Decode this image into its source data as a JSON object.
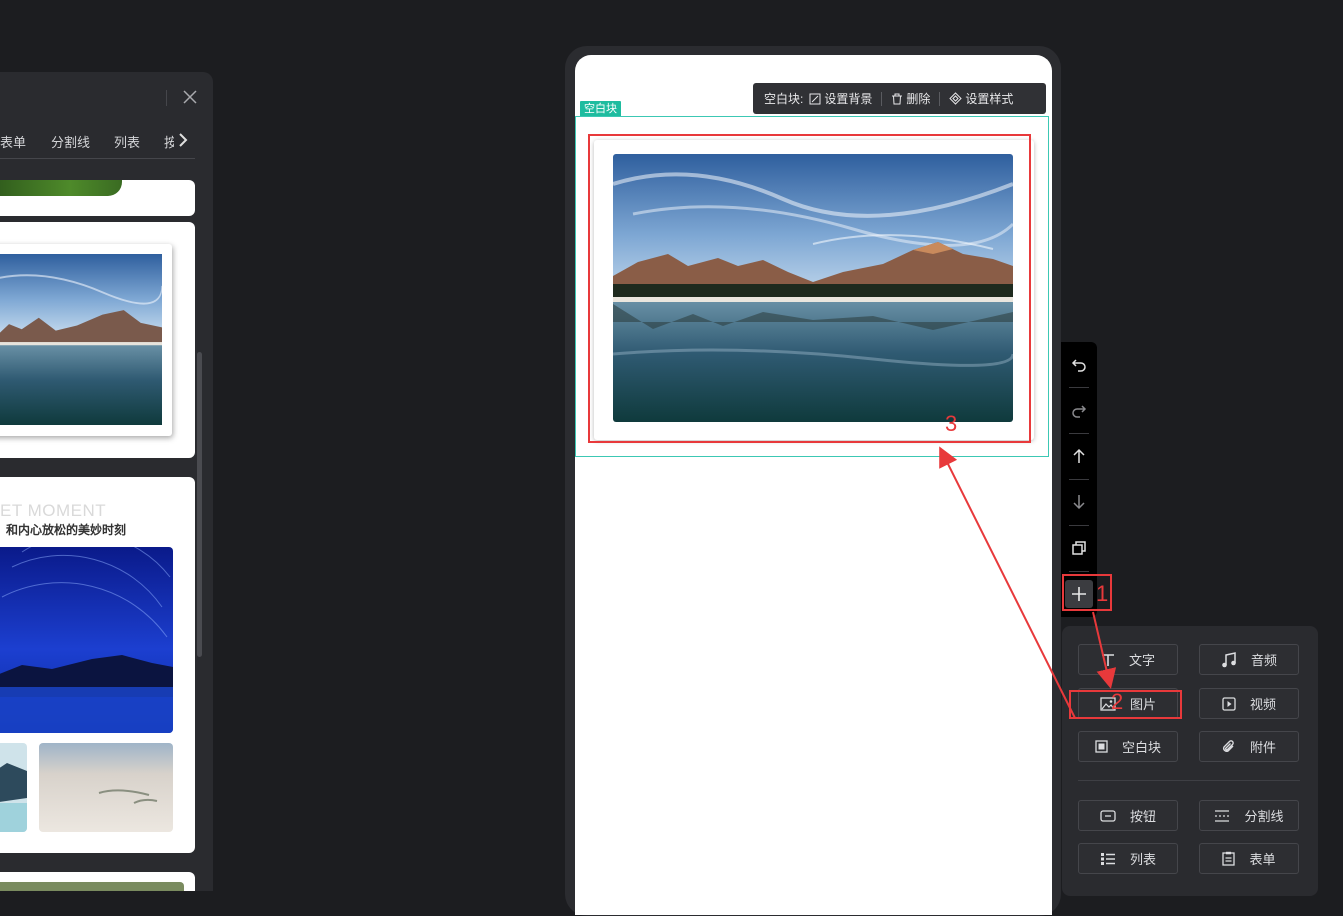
{
  "left_panel": {
    "tabs": [
      "表单",
      "分割线",
      "列表",
      "按"
    ],
    "templates": {
      "moment_title": "ET MOMENT",
      "moment_subtitle": "和内心放松的美妙时刻"
    }
  },
  "editor": {
    "toolbar": {
      "label": "空白块:",
      "set_background": "设置背景",
      "delete": "删除",
      "set_style": "设置样式"
    },
    "block_tag": "空白块"
  },
  "side_toolbar": {
    "icons": [
      "undo-icon",
      "redo-icon",
      "move-up-icon",
      "move-down-icon",
      "copy-icon",
      "add-icon"
    ]
  },
  "components": {
    "items": [
      {
        "label": "文字",
        "icon": "text-icon"
      },
      {
        "label": "音频",
        "icon": "music-icon"
      },
      {
        "label": "图片",
        "icon": "image-icon"
      },
      {
        "label": "视频",
        "icon": "video-icon"
      },
      {
        "label": "空白块",
        "icon": "blank-block-icon"
      },
      {
        "label": "附件",
        "icon": "paperclip-icon"
      },
      {
        "label": "按钮",
        "icon": "button-icon"
      },
      {
        "label": "分割线",
        "icon": "divider-icon"
      },
      {
        "label": "列表",
        "icon": "list-icon"
      },
      {
        "label": "表单",
        "icon": "form-icon"
      }
    ]
  },
  "annotations": {
    "step1": "1",
    "step2": "2",
    "step3": "3",
    "color": "#e8393b"
  },
  "colors": {
    "background": "#1c1d20",
    "accent": "#1ebc9f",
    "block_outline": "#3cc8b4"
  }
}
